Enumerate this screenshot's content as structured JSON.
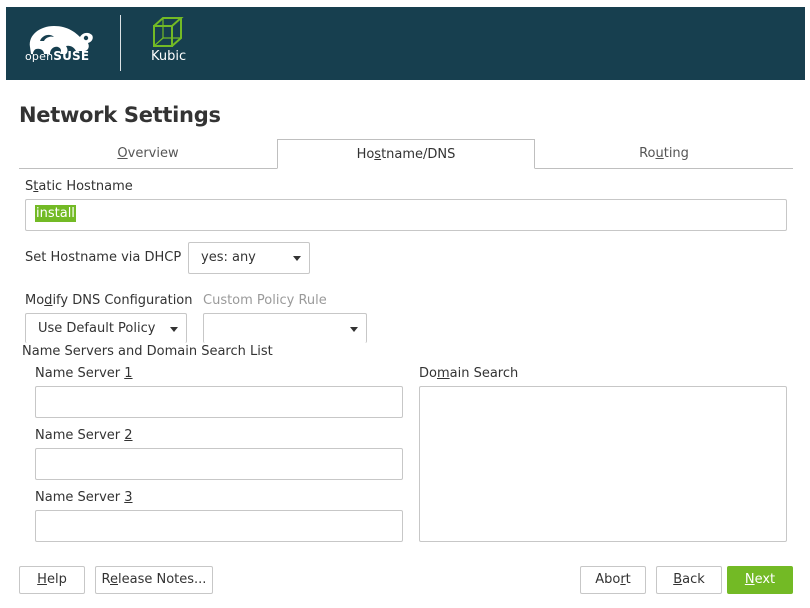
{
  "header": {
    "brand_prefix": "open",
    "brand_suffix": "SUSE",
    "brand_logo_icon": "opensuse-chameleon-icon",
    "product_label": "Kubic",
    "product_icon": "kubic-cube-icon",
    "background_color": "#173f4f"
  },
  "page": {
    "title": "Network Settings"
  },
  "tabs": [
    {
      "pre": "",
      "key": "O",
      "post": "verview",
      "active": false
    },
    {
      "pre": "Ho",
      "key": "s",
      "post": "tname/DNS",
      "active": true
    },
    {
      "pre": "Ro",
      "key": "u",
      "post": "ting",
      "active": false
    }
  ],
  "hostname": {
    "label_pre": "S",
    "label_key": "t",
    "label_post": "atic Hostname",
    "value": "install"
  },
  "dhcp": {
    "label": "Set Hostname via DHCP",
    "selected": "yes: any"
  },
  "dns": {
    "label_pre": "Mo",
    "label_key": "d",
    "label_post": "ify DNS Configuration",
    "selected": "Use Default Policy"
  },
  "policy": {
    "label": "Custom Policy Rule",
    "selected": ""
  },
  "name_servers": {
    "section_label": "Name Servers and Domain Search List",
    "servers": [
      {
        "label_pre": "Name Server ",
        "label_key": "1",
        "value": ""
      },
      {
        "label_pre": "Name Server ",
        "label_key": "2",
        "value": ""
      },
      {
        "label_pre": "Name Server ",
        "label_key": "3",
        "value": ""
      }
    ],
    "domain_search_pre": "Do",
    "domain_search_key": "m",
    "domain_search_post": "ain Search",
    "domain_search_value": ""
  },
  "buttons": {
    "help_key": "H",
    "help_post": "elp",
    "notes_pre": "R",
    "notes_key": "e",
    "notes_post": "lease Notes...",
    "abort_pre": "Abo",
    "abort_key": "r",
    "abort_post": "t",
    "back_key": "B",
    "back_post": "ack",
    "next_key": "N",
    "next_post": "ext"
  },
  "colors": {
    "accent": "#73ba25",
    "header_bg": "#173f4f"
  }
}
